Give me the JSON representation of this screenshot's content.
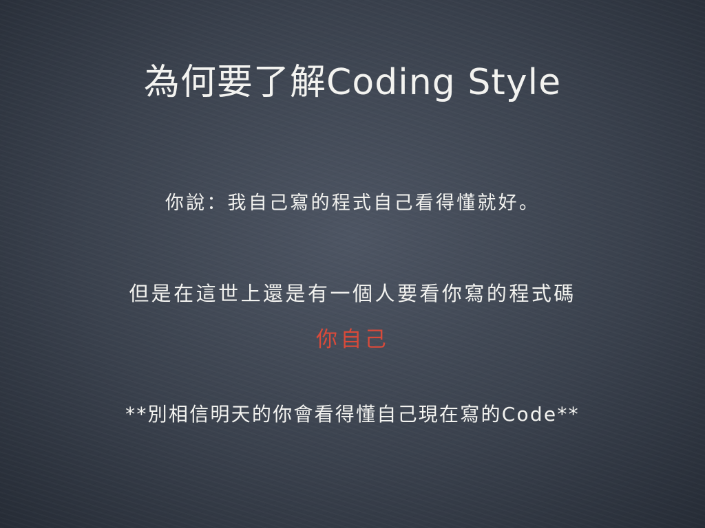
{
  "slide": {
    "title": "為何要了解Coding Style",
    "line1": "你說：我自己寫的程式自己看得懂就好。",
    "line2": "但是在這世上還是有一個人要看你寫的程式碼",
    "highlight": "你自己",
    "line3": "**別相信明天的你會看得懂自己現在寫的Code**"
  },
  "colors": {
    "background": "#3d4450",
    "text": "#f3f3f0",
    "highlight": "#d94a3a"
  }
}
